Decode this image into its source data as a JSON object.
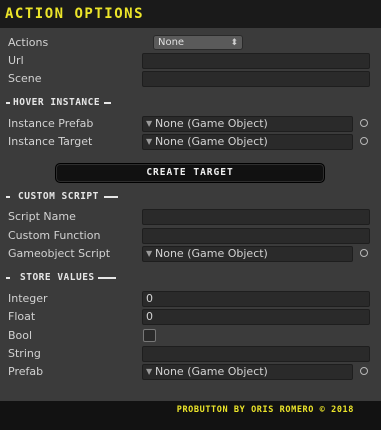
{
  "title": "ACTION OPTIONS",
  "fields": {
    "actions": {
      "label": "Actions",
      "value": "None"
    },
    "url": {
      "label": "Url",
      "value": ""
    },
    "scene": {
      "label": "Scene",
      "value": ""
    }
  },
  "hover_instance": {
    "heading": "HOVER INSTANCE",
    "instance_prefab": {
      "label": "Instance Prefab",
      "value": "None (Game Object)"
    },
    "instance_target": {
      "label": "Instance Target",
      "value": "None (Game Object)"
    },
    "create_target_label": "CREATE TARGET"
  },
  "custom_script": {
    "heading": "CUSTOM SCRIPT",
    "script_name": {
      "label": "Script Name",
      "value": ""
    },
    "custom_function": {
      "label": "Custom Function",
      "value": ""
    },
    "gameobject_script": {
      "label": "Gameobject Script",
      "value": "None (Game Object)"
    }
  },
  "store_values": {
    "heading": "STORE VALUES",
    "integer": {
      "label": "Integer",
      "value": "0"
    },
    "float": {
      "label": "Float",
      "value": "0"
    },
    "bool": {
      "label": "Bool",
      "checked": false
    },
    "string": {
      "label": "String",
      "value": ""
    },
    "prefab": {
      "label": "Prefab",
      "value": "None (Game Object)"
    }
  },
  "footer": "PROBUTTON BY ORIS ROMERO © 2018",
  "colors": {
    "accent": "#ece52a",
    "background": "#3b3b3b",
    "field": "#2a2a2a",
    "bar": "#1a1a1a"
  },
  "icons": {
    "object_field": "object-field-icon",
    "picker": "object-picker-icon",
    "dropdown_caret": "up-down-caret-icon"
  }
}
